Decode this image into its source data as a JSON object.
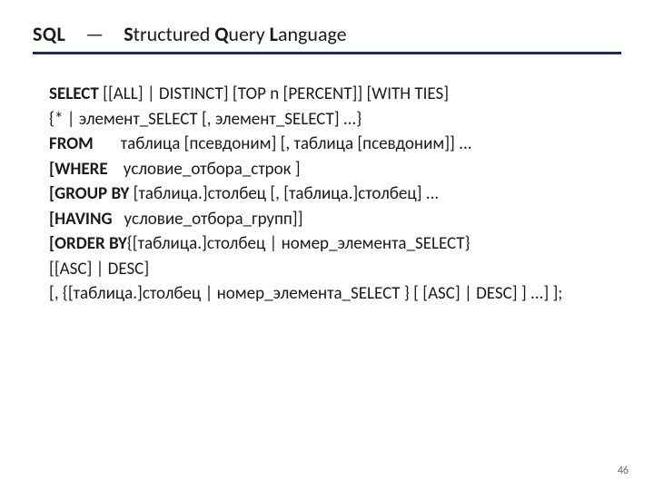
{
  "header": {
    "abbr": "SQL",
    "dash": "—",
    "full_s": "S",
    "full_1": "tructured ",
    "full_q": "Q",
    "full_2": "uery ",
    "full_l": "L",
    "full_3": "anguage"
  },
  "syntax": {
    "l1_kw": "SELECT ",
    "l1_a": "[[ALL] | DISTINCT] [",
    "l1_top": "ТОР n",
    "l1_b": " [PERCENT]] [WITH TIES]",
    "l2": " {* | элемент_SELECT [, элемент_SELECT] ...}",
    "l3_kw": "FROM",
    "l3_rest": "       таблица [псевдоним] [, таблица [псевдоним]] ...",
    "l4_kw": "[WHERE",
    "l4_rest": "    условие_отбора_строк ]",
    "l5_kw": "[GROUP BY",
    "l5_rest": " [таблица.]столбец [, [таблица.]столбец] ...",
    "l6_kw": "[HAVING",
    "l6_rest": "   условие_отбора_групп]]",
    "l7_kw": "[ORDER BY",
    "l7_rest": "{[таблица.]столбец | номер_элемента_SELECT}",
    "l8": "[[ASC] | DESC]",
    "l9": "[, {[таблица.]столбец | номер_элемента_SELECT } [ [ASC] | DESC] ] ...] ];"
  },
  "page_number": "46"
}
